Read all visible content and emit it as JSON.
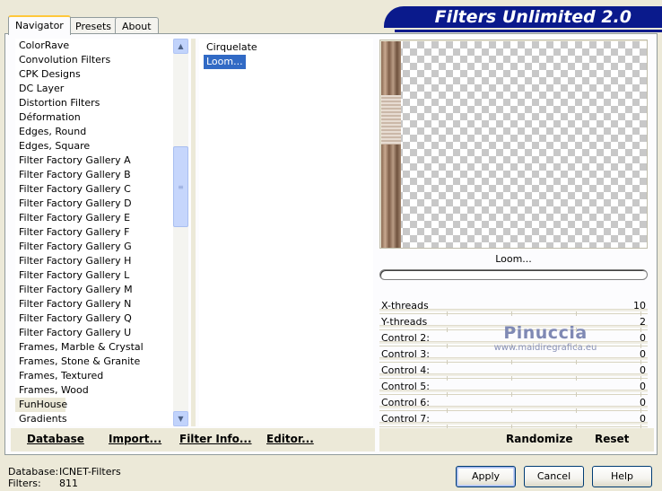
{
  "tabs": [
    {
      "label": "Navigator"
    },
    {
      "label": "Presets"
    },
    {
      "label": "About"
    }
  ],
  "banner": {
    "title": "Filters Unlimited 2.0"
  },
  "categories": [
    "ColorRave",
    "Convolution Filters",
    "CPK Designs",
    "DC Layer",
    "Distortion Filters",
    "Déformation",
    "Edges, Round",
    "Edges, Square",
    "Filter Factory Gallery A",
    "Filter Factory Gallery B",
    "Filter Factory Gallery C",
    "Filter Factory Gallery D",
    "Filter Factory Gallery E",
    "Filter Factory Gallery F",
    "Filter Factory Gallery G",
    "Filter Factory Gallery H",
    "Filter Factory Gallery L",
    "Filter Factory Gallery M",
    "Filter Factory Gallery N",
    "Filter Factory Gallery Q",
    "Filter Factory Gallery U",
    "Frames, Marble & Crystal",
    "Frames, Stone & Granite",
    "Frames, Textured",
    "Frames, Wood",
    "FunHouse",
    "Gradients"
  ],
  "selected_category": "FunHouse",
  "filters": [
    {
      "label": "Cirquelate",
      "selected": false
    },
    {
      "label": "Loom...",
      "selected": true
    }
  ],
  "toolbar": {
    "database": "Database",
    "import": "Import...",
    "filter_info": "Filter Info...",
    "editor": "Editor..."
  },
  "preview": {
    "filter_name": "Loom..."
  },
  "controls": [
    {
      "label": "X-threads",
      "value": "10"
    },
    {
      "label": "Y-threads",
      "value": "2"
    },
    {
      "label": "Control 2:",
      "value": "0"
    },
    {
      "label": "Control 3:",
      "value": "0"
    },
    {
      "label": "Control 4:",
      "value": "0"
    },
    {
      "label": "Control 5:",
      "value": "0"
    },
    {
      "label": "Control 6:",
      "value": "0"
    },
    {
      "label": "Control 7:",
      "value": "0"
    }
  ],
  "watermark": {
    "title": "Pinuccia",
    "subtitle": "www.maidiregrafica.eu"
  },
  "right_toolbar": {
    "randomize": "Randomize",
    "reset": "Reset"
  },
  "status": {
    "database_label": "Database:",
    "database_value": "ICNET-Filters",
    "filters_label": "Filters:",
    "filters_value": "811"
  },
  "buttons": {
    "apply": "Apply",
    "cancel": "Cancel",
    "help": "Help"
  }
}
